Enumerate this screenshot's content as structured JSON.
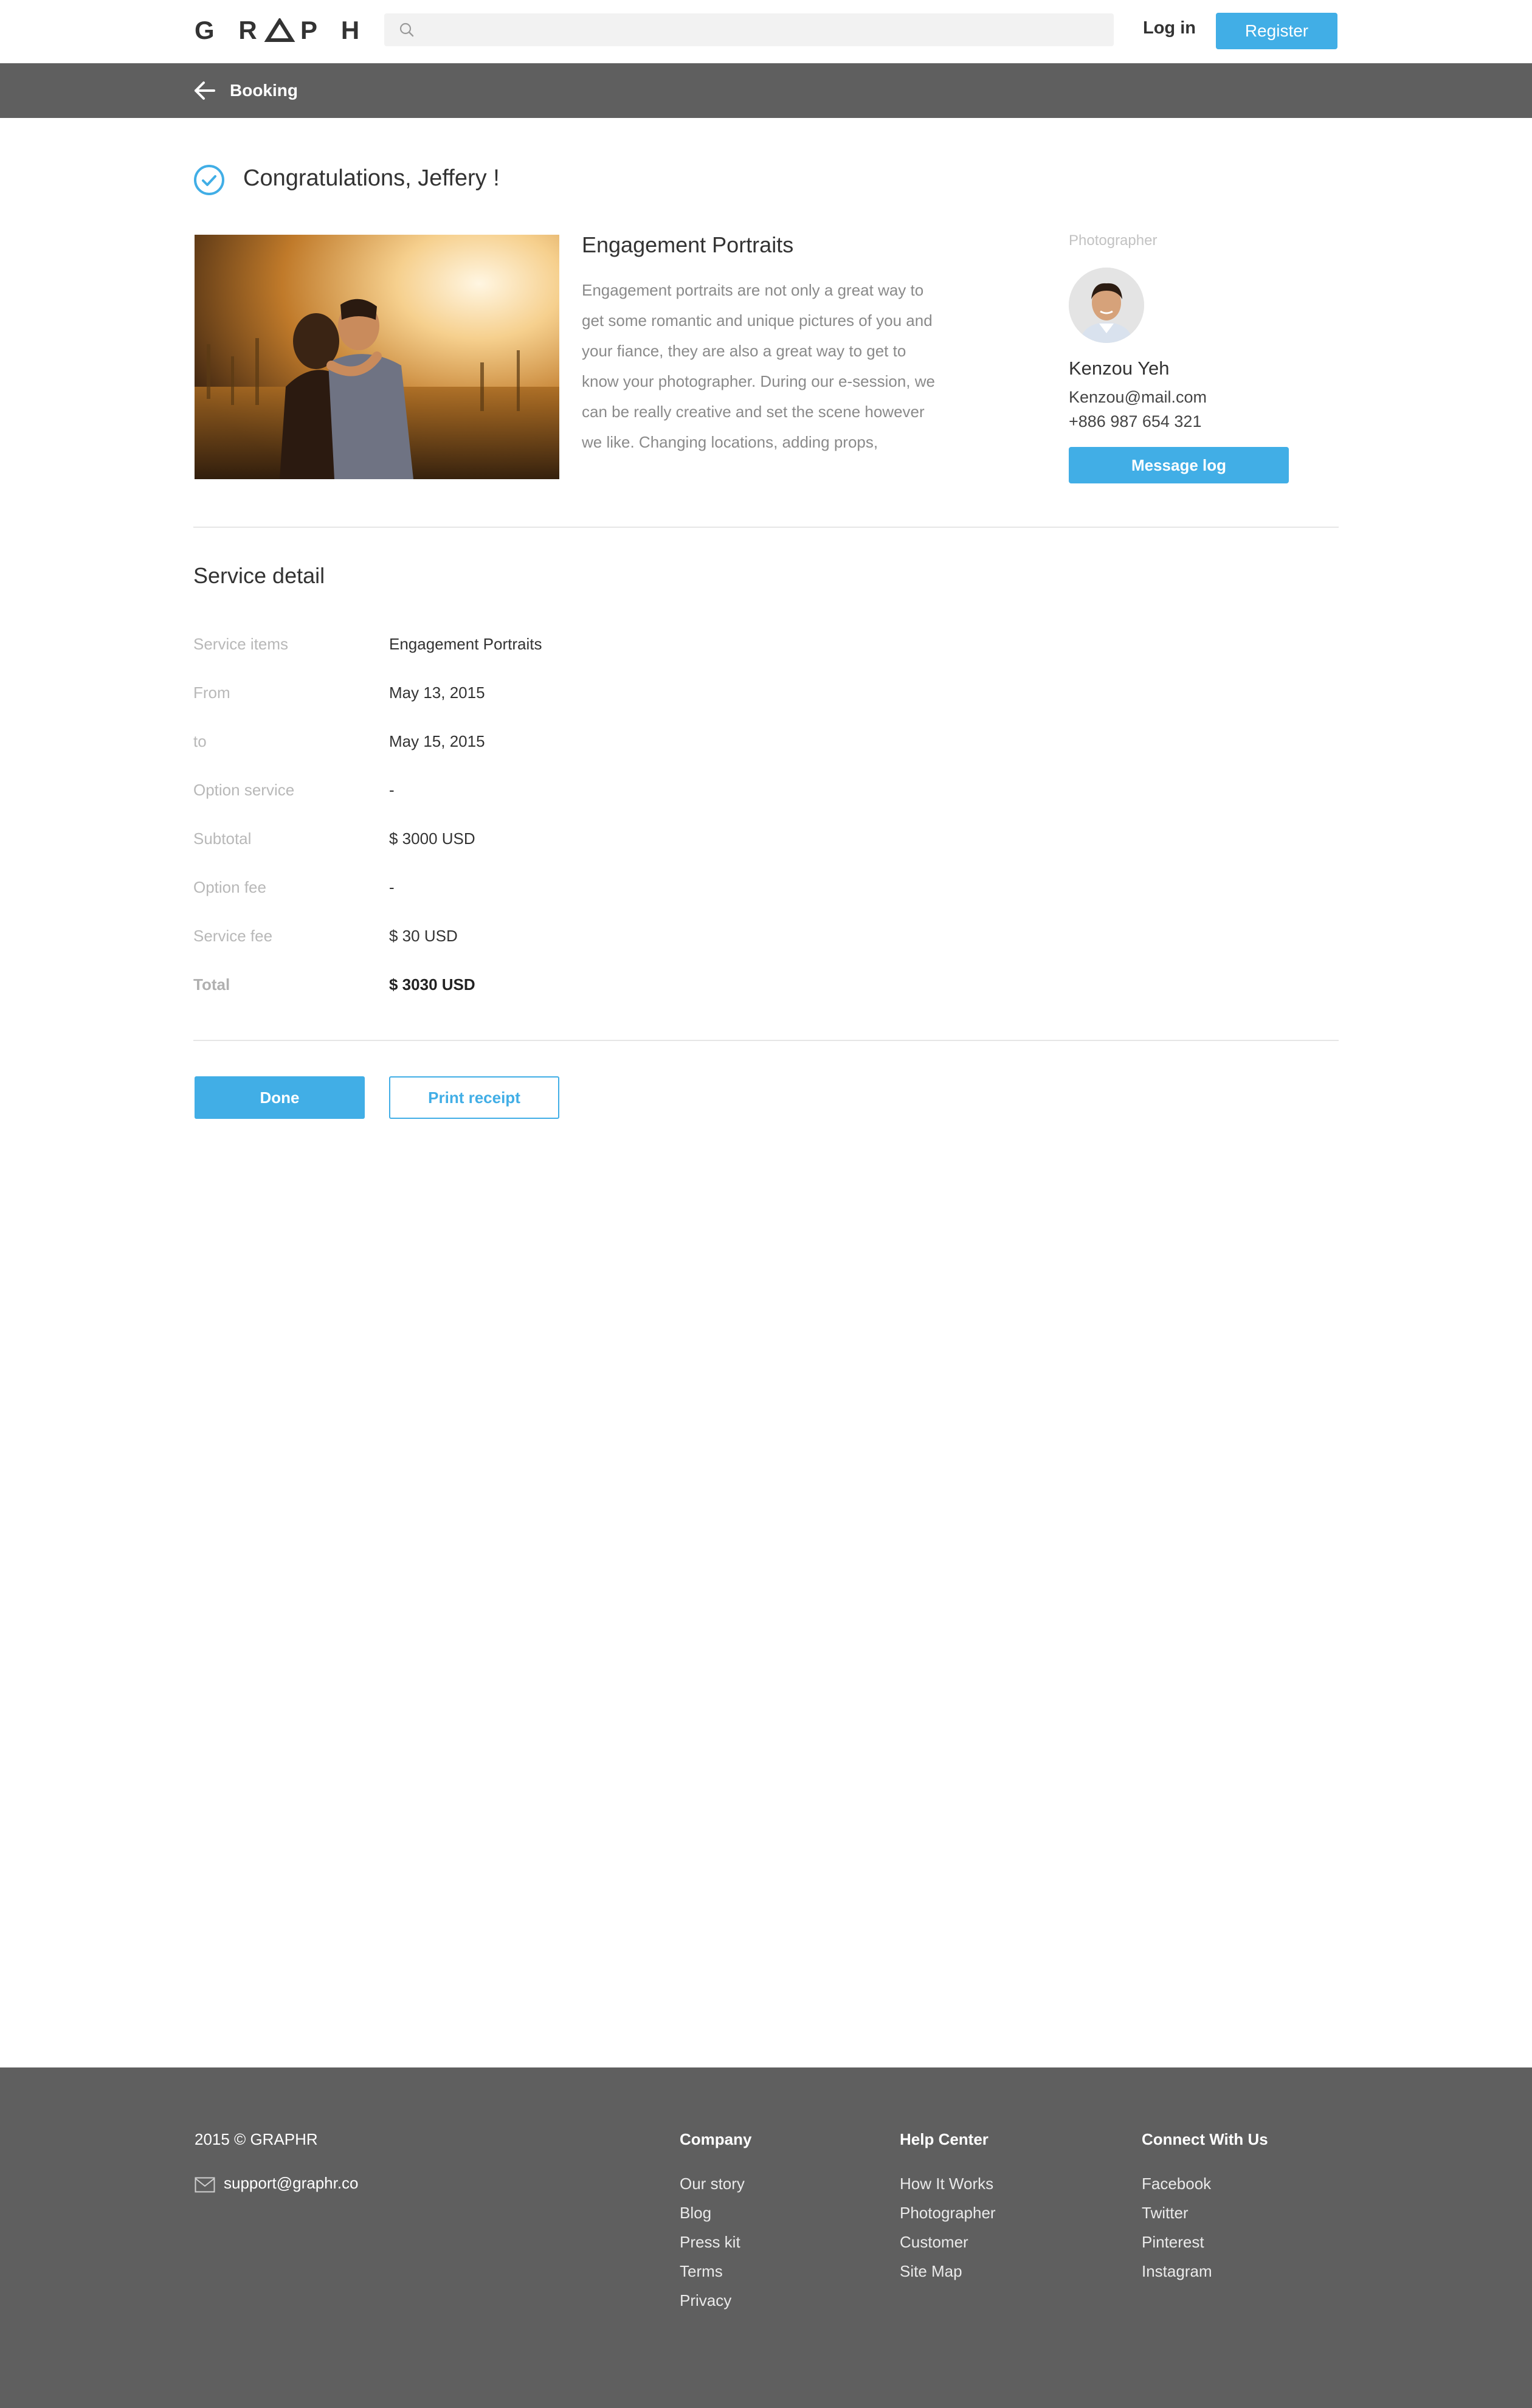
{
  "header": {
    "logo": "GRAPHR",
    "search_placeholder": "",
    "login_label": "Log in",
    "register_label": "Register"
  },
  "subbar": {
    "title": "Booking"
  },
  "congrats": {
    "message": "Congratulations, Jeffery !"
  },
  "service": {
    "title": "Engagement Portraits",
    "description": "Engagement portraits are not only a great way to get some romantic and unique pictures of you and your fiance, they are also a great way to get to know your photographer.  During our e-session, we can be really creative and set the scene however we like.  Changing locations, adding props,"
  },
  "photographer": {
    "label": "Photographer",
    "name": "Kenzou Yeh",
    "email": "Kenzou@mail.com",
    "phone": "+886 987 654 321",
    "message_button": "Message log"
  },
  "service_detail": {
    "title": "Service detail",
    "rows": [
      {
        "label": "Service items",
        "value": "Engagement Portraits"
      },
      {
        "label": "From",
        "value": "May 13, 2015"
      },
      {
        "label": "to",
        "value": "May 15, 2015"
      },
      {
        "label": "Option service",
        "value": "-"
      },
      {
        "label": "Subtotal",
        "value": "$ 3000 USD"
      },
      {
        "label": "Option fee",
        "value": "-"
      },
      {
        "label": "Service fee",
        "value": "$ 30 USD"
      },
      {
        "label": "Total",
        "value": "$ 3030 USD"
      }
    ]
  },
  "actions": {
    "done_label": "Done",
    "print_label": "Print receipt"
  },
  "footer": {
    "copyright": "2015 © GRAPHR",
    "support_email": "support@graphr.co",
    "columns": [
      {
        "title": "Company",
        "links": [
          "Our story",
          "Blog",
          "Press kit",
          "Terms",
          "Privacy"
        ]
      },
      {
        "title": "Help Center",
        "links": [
          "How It Works",
          "Photographer",
          "Customer",
          "Site Map"
        ]
      },
      {
        "title": "Connect With Us",
        "links": [
          "Facebook",
          "Twitter",
          "Pinterest",
          "Instagram"
        ]
      }
    ]
  },
  "colors": {
    "accent": "#41aee6",
    "bar": "#5f5f5f",
    "text": "#333333",
    "muted": "#b8b8b8"
  },
  "icons": [
    "search-icon",
    "arrow-left-icon",
    "check-circle-icon",
    "mail-icon"
  ]
}
